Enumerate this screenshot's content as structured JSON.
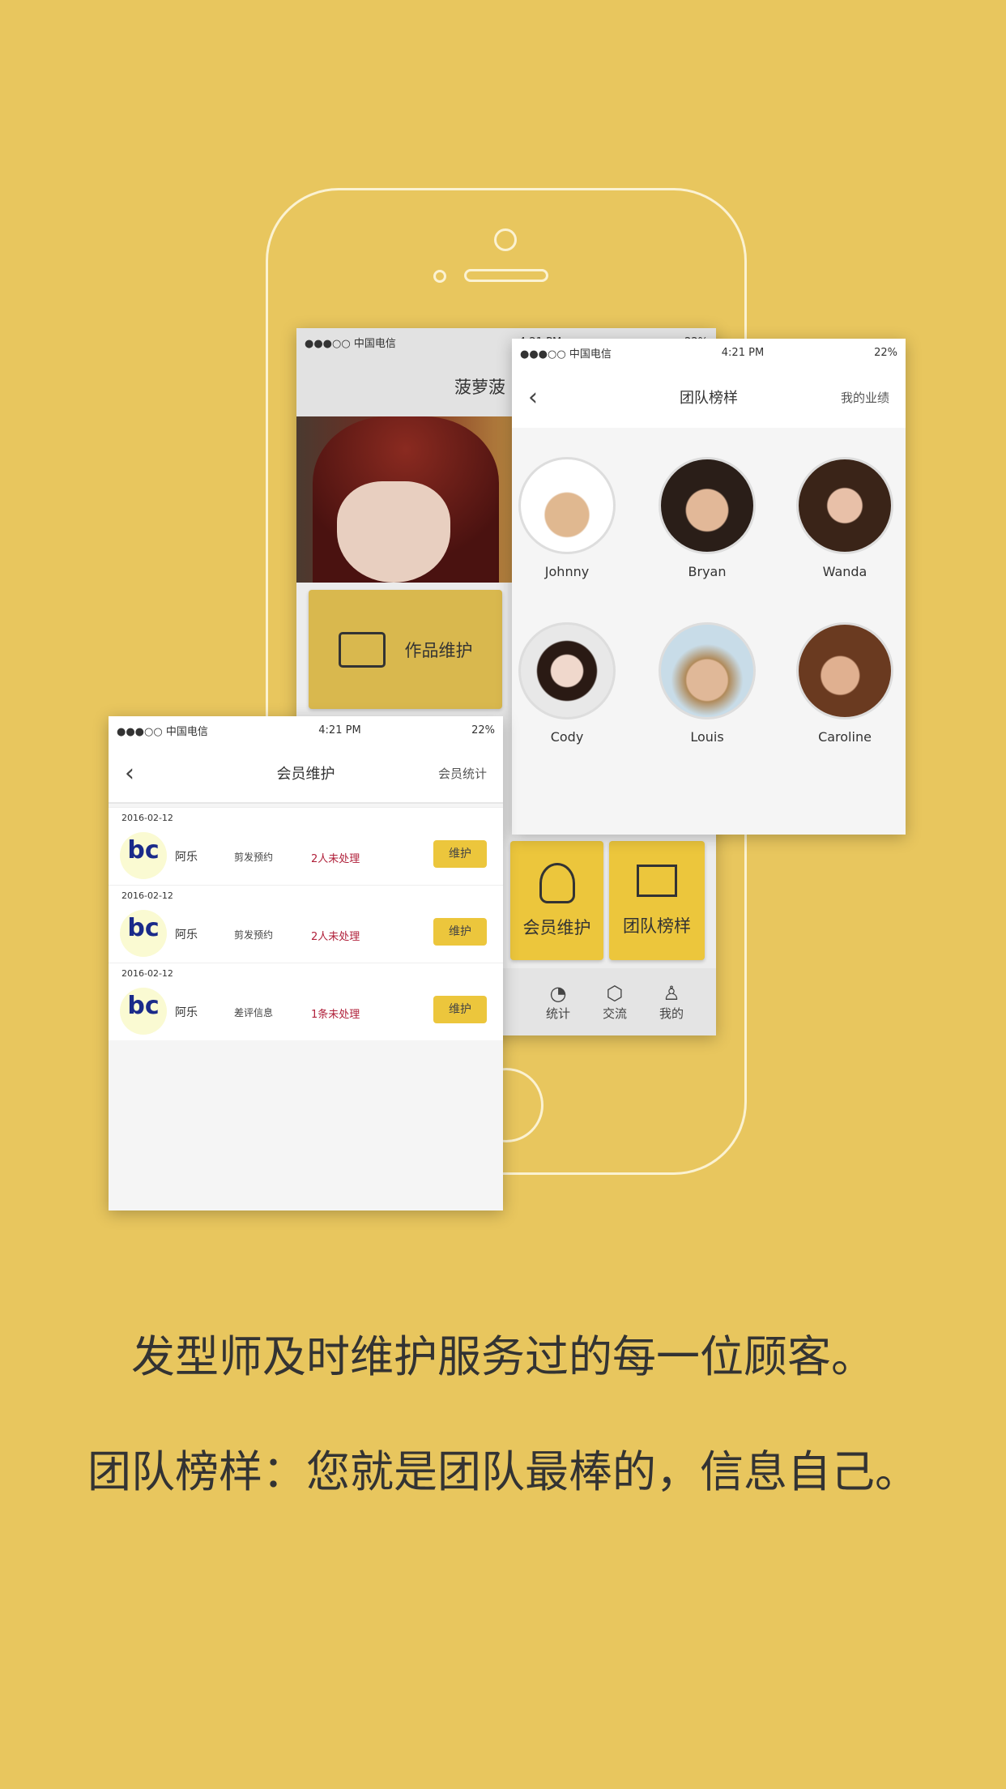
{
  "status": {
    "carrier": "●●●○○ 中国电信",
    "time": "4:21 PM",
    "battery": "22%"
  },
  "main_screen": {
    "title": "菠萝菠",
    "tile_works": "作品维护",
    "tile_members": "会员维护",
    "tile_team": "团队榜样",
    "tabs": [
      {
        "label": "统计",
        "icon": "stats-icon"
      },
      {
        "label": "交流",
        "icon": "cube-icon"
      },
      {
        "label": "我的",
        "icon": "person-icon"
      }
    ]
  },
  "team_screen": {
    "title": "团队榜样",
    "right": "我的业绩",
    "people": [
      "Johnny",
      "Bryan",
      "Wanda",
      "Cody",
      "Louis",
      "Caroline"
    ]
  },
  "member_screen": {
    "title": "会员维护",
    "right": "会员统计",
    "rows": [
      {
        "date": "2016-02-12",
        "name": "阿乐",
        "type": "剪发预约",
        "status": "2人未处理",
        "action": "维护"
      },
      {
        "date": "2016-02-12",
        "name": "阿乐",
        "type": "剪发预约",
        "status": "2人未处理",
        "action": "维护"
      },
      {
        "date": "2016-02-12",
        "name": "阿乐",
        "type": "差评信息",
        "status": "1条未处理",
        "action": "维护"
      }
    ]
  },
  "captions": [
    "发型师及时维护服务过的每一位顾客。",
    "团队榜样：您就是团队最棒的，信息自己。"
  ],
  "colors": {
    "background": "#e8c65e",
    "accent": "#ecc63c",
    "alert": "#b0203a"
  }
}
